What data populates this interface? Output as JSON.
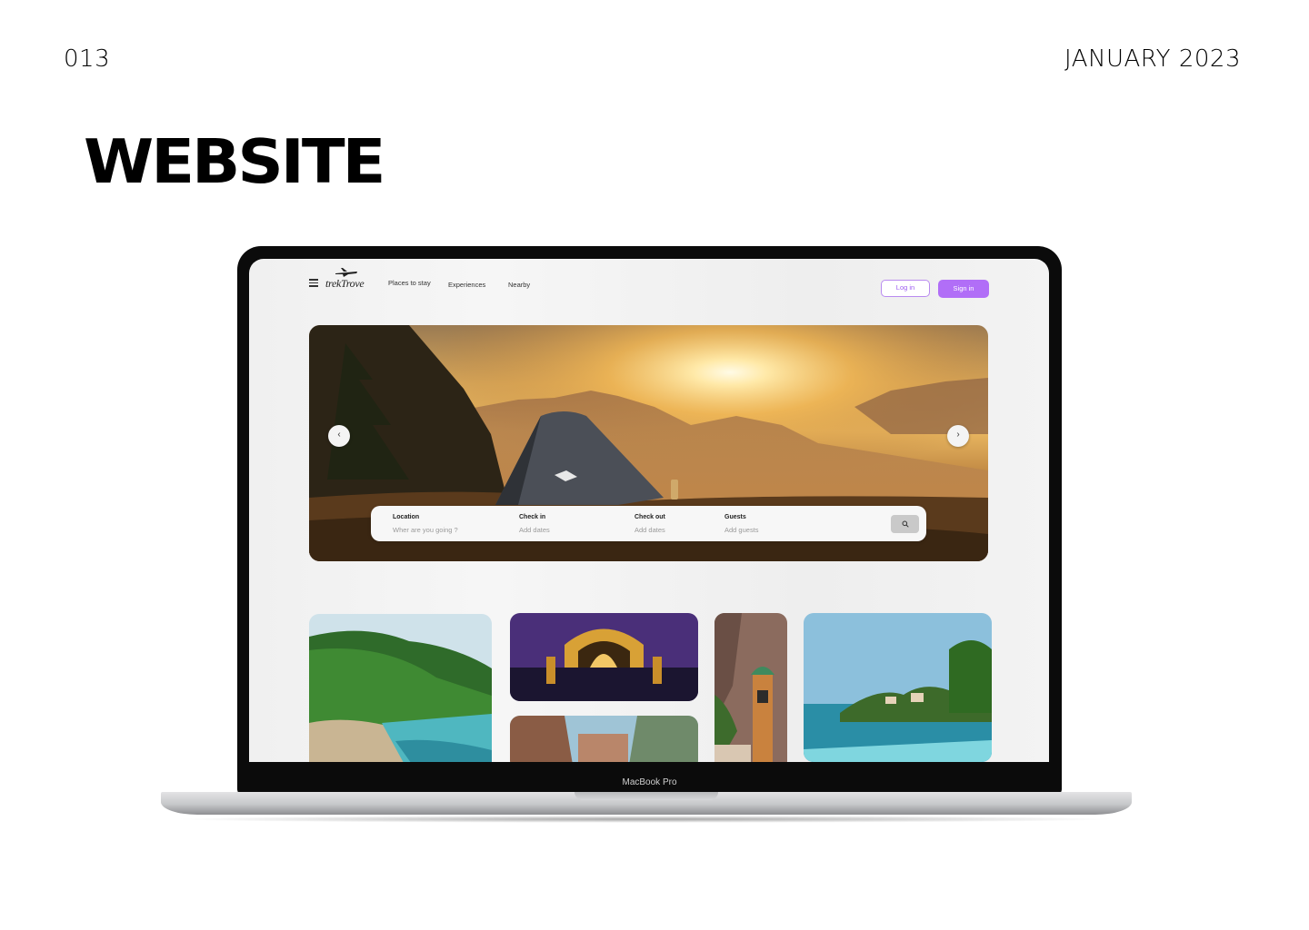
{
  "page": {
    "number": "013",
    "date": "JANUARY 2023",
    "title": "WEBSITE"
  },
  "device": {
    "label": "MacBook Pro"
  },
  "site": {
    "logo_text": "trekTrove",
    "nav": [
      "Places to stay",
      "Experiences",
      "Nearby"
    ],
    "login_label": "Log in",
    "signin_label": "Sign in",
    "search": {
      "fields": [
        {
          "label": "Location",
          "placeholder": "Wher are you going ?"
        },
        {
          "label": "Check in",
          "placeholder": "Add dates"
        },
        {
          "label": "Check out",
          "placeholder": "Add dates"
        },
        {
          "label": "Guests",
          "placeholder": "Add guests"
        }
      ]
    },
    "gallery": [
      "tropical-beach-photo",
      "palace-of-fine-arts-photo",
      "street-photo",
      "cliff-tower-photo",
      "island-pool-photo"
    ]
  },
  "colors": {
    "accent": "#b16ef7",
    "accent_dark": "#9d5cf0",
    "bezel": "#0b0b0b"
  },
  "icons": [
    "menu-icon",
    "plane-icon",
    "chevron-left-icon",
    "chevron-right-icon",
    "search-icon"
  ]
}
